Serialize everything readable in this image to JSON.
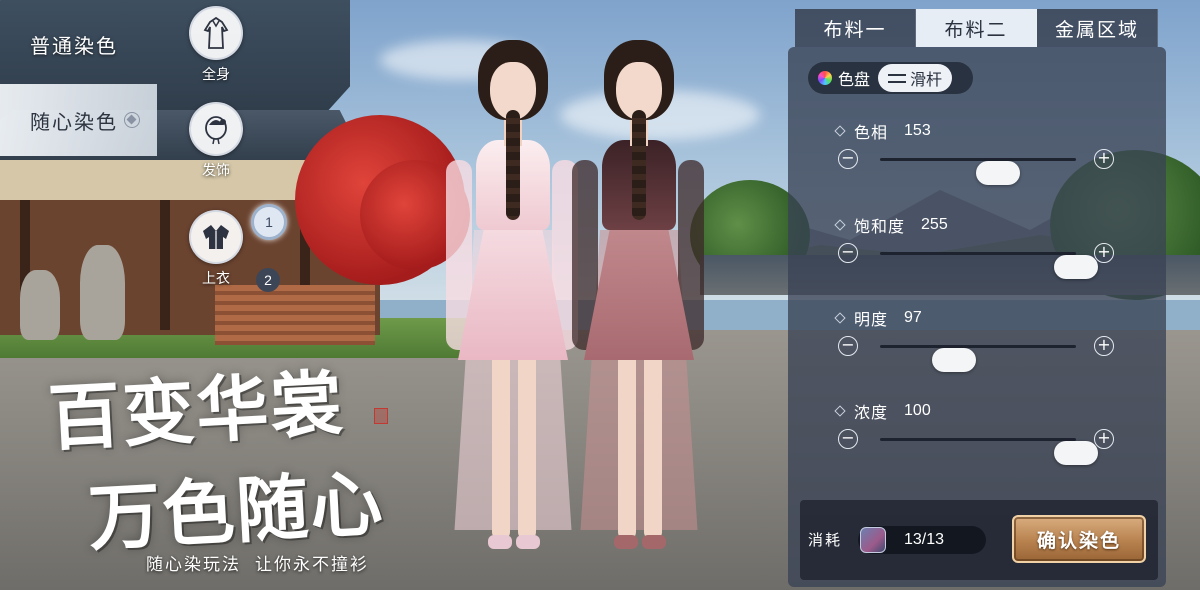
{
  "dye_modes": [
    {
      "label": "普通染色",
      "active": false
    },
    {
      "label": "随心染色",
      "active": true
    }
  ],
  "parts": [
    {
      "label": "全身",
      "icon": "full-body-robe-icon"
    },
    {
      "label": "发饰",
      "icon": "hair-ornament-icon"
    },
    {
      "label": "上衣",
      "icon": "upper-garment-icon"
    }
  ],
  "badges": {
    "first": "1",
    "second": "2"
  },
  "promo": {
    "line1": "百变华裳",
    "line2": "万色随心",
    "tagline_a": "随心染玩法",
    "tagline_b": "让你永不撞衫"
  },
  "fabric_tabs": [
    {
      "label": "布料一",
      "active": false
    },
    {
      "label": "布料二",
      "active": true
    },
    {
      "label": "金属区域",
      "active": false
    }
  ],
  "mode_toggle": {
    "palette_label": "色盘",
    "slider_label": "滑杆",
    "active": "slider"
  },
  "params": [
    {
      "name": "色相",
      "value": "153",
      "fraction": 0.6
    },
    {
      "name": "饱和度",
      "value": "255",
      "fraction": 1.0
    },
    {
      "name": "明度",
      "value": "97",
      "fraction": 0.38
    },
    {
      "name": "浓度",
      "value": "100",
      "fraction": 1.0
    }
  ],
  "stepper": {
    "minus": "−",
    "plus": "+"
  },
  "cost": {
    "label": "消耗",
    "value": "13/13",
    "icon": "dye-material-icon"
  },
  "confirm_label": "确认染色",
  "colors": {
    "panel": "#3a4254",
    "tab_active": "#eef1f6",
    "confirm": "#b8824f",
    "outfit_left": "#f3cfd6",
    "outfit_right": "#b67a7d"
  }
}
